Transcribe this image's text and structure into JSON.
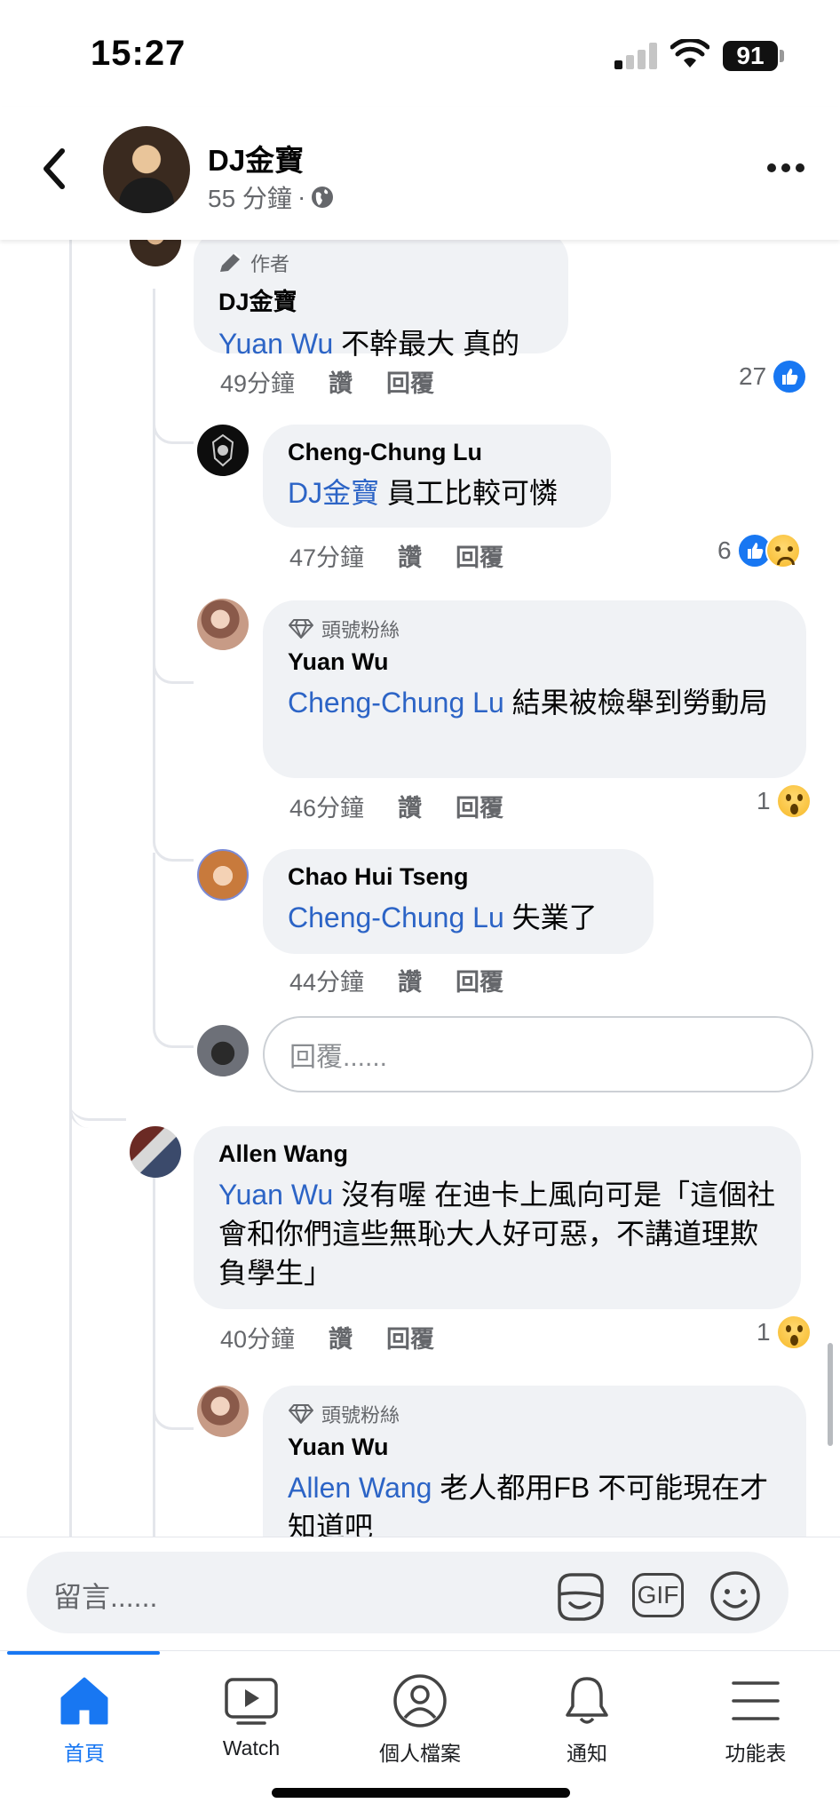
{
  "status_bar": {
    "time": "15:27",
    "battery": "91"
  },
  "header": {
    "page_name": "DJ金寶",
    "time_ago": "55 分鐘",
    "separator": "·"
  },
  "comments": [
    {
      "badge": "作者",
      "name": "DJ金寶",
      "mention": "Yuan Wu",
      "text": " 不幹最大 真的",
      "time": "49分鐘",
      "like": "讚",
      "reply": "回覆",
      "reaction_count": "27"
    },
    {
      "name": "Cheng-Chung Lu",
      "mention": "DJ金寶",
      "text": " 員工比較可憐",
      "time": "47分鐘",
      "like": "讚",
      "reply": "回覆",
      "reaction_count": "6"
    },
    {
      "badge": "頭號粉絲",
      "name": "Yuan Wu",
      "mention": "Cheng-Chung Lu",
      "text": " 結果被檢舉到勞動局",
      "time": "46分鐘",
      "like": "讚",
      "reply": "回覆",
      "reaction_count": "1"
    },
    {
      "name": "Chao Hui Tseng",
      "mention": "Cheng-Chung Lu",
      "text": " 失業了",
      "time": "44分鐘",
      "like": "讚",
      "reply": "回覆"
    },
    {
      "name": "Allen Wang",
      "mention": "Yuan Wu",
      "text": " 沒有喔 在迪卡上風向可是「這個社會和你們這些無恥大人好可惡，不講道理欺負學生」",
      "time": "40分鐘",
      "like": "讚",
      "reply": "回覆",
      "reaction_count": "1"
    },
    {
      "badge": "頭號粉絲",
      "name": "Yuan Wu",
      "mention": "Allen Wang",
      "text": " 老人都用FB 不可能現在才知道吧"
    }
  ],
  "reply_input": {
    "placeholder": "回覆......"
  },
  "composer": {
    "placeholder": "留言......",
    "gif_label": "GIF"
  },
  "tabs": [
    {
      "label": "首頁",
      "icon": "home-icon",
      "active": true
    },
    {
      "label": "Watch",
      "icon": "watch-icon"
    },
    {
      "label": "個人檔案",
      "icon": "profile-icon"
    },
    {
      "label": "通知",
      "icon": "bell-icon"
    },
    {
      "label": "功能表",
      "icon": "menu-icon"
    }
  ],
  "colors": {
    "accent": "#1877f2",
    "mention": "#2c64c6",
    "bubble": "#f0f2f5",
    "secondary_text": "#65676b"
  }
}
